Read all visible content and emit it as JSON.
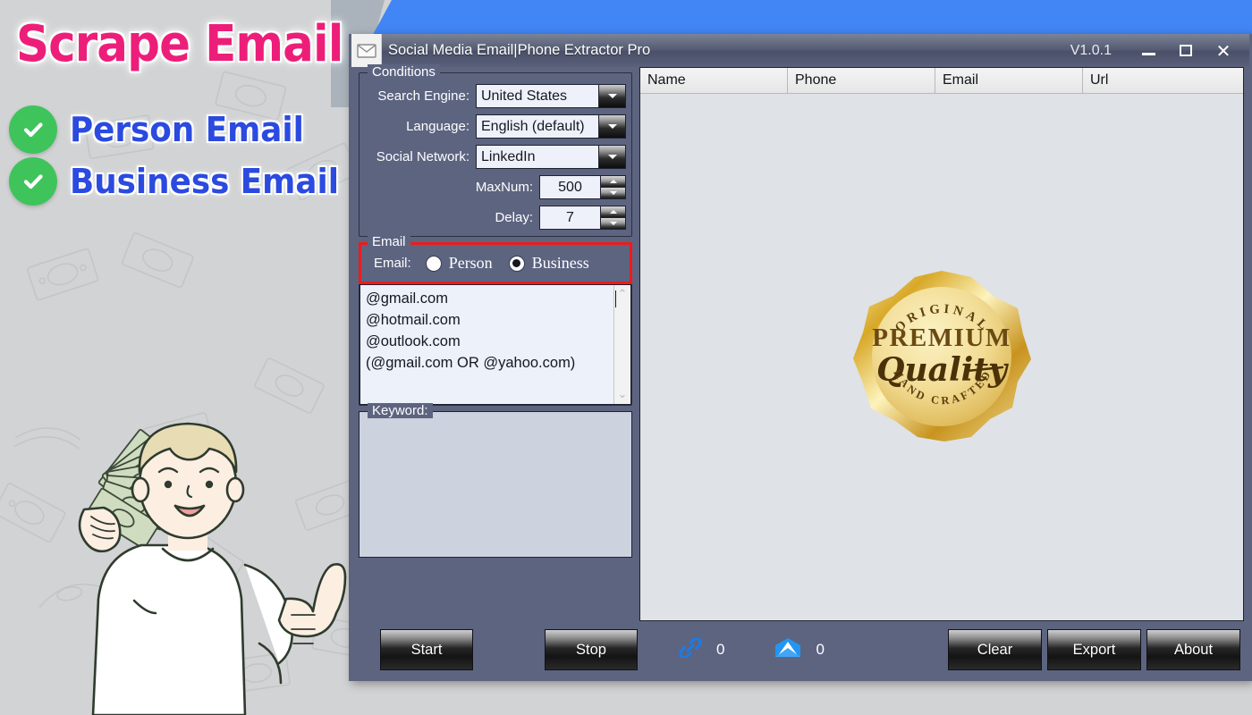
{
  "promo": {
    "title": "Scrape Email",
    "bullets": [
      {
        "label": "Person Email",
        "icon": "check-circle-icon"
      },
      {
        "label": "Business Email",
        "icon": "check-circle-icon"
      }
    ]
  },
  "window": {
    "icon": "envelope-icon",
    "title": "Social Media Email|Phone Extractor Pro",
    "version": "V1.0.1",
    "controls": {
      "minimize": "minimize-icon",
      "maximize": "maximize-icon",
      "close": "close-icon"
    }
  },
  "conditions": {
    "legend": "Conditions",
    "fields": [
      {
        "label": "Search Engine:",
        "value": "United States",
        "type": "combo"
      },
      {
        "label": "Language:",
        "value": "English (default)",
        "type": "combo"
      },
      {
        "label": "Social Network:",
        "value": "LinkedIn",
        "type": "combo"
      },
      {
        "label": "MaxNum:",
        "value": "500",
        "type": "spinner"
      },
      {
        "label": "Delay:",
        "value": "7",
        "type": "spinner"
      }
    ]
  },
  "email": {
    "legend": "Email",
    "row_label": "Email:",
    "options": [
      {
        "label": "Person",
        "checked": false
      },
      {
        "label": "Business",
        "checked": true
      }
    ],
    "highlight_color": "#ee1b1b",
    "list": [
      "@gmail.com",
      "@hotmail.com",
      "@outlook.com",
      "(@gmail.com OR @yahoo.com)"
    ],
    "scroll_up": "scroll-up-icon",
    "scroll_down": "scroll-down-icon"
  },
  "keyword": {
    "legend": "Keyword:",
    "value": "",
    "placeholder": ""
  },
  "results": {
    "columns": [
      "Name",
      "Phone",
      "Email",
      "Url"
    ],
    "rows": [],
    "badge": {
      "top_text": "ORIGINAL",
      "main_text": "PREMIUM",
      "script_text": "Quality",
      "bottom_text": "HAND CRAFTED",
      "color": "#d9a326"
    }
  },
  "footer": {
    "start_label": "Start",
    "stop_label": "Stop",
    "counters": [
      {
        "icon": "link-icon",
        "value": "0"
      },
      {
        "icon": "mail-icon",
        "value": "0"
      }
    ],
    "clear_label": "Clear",
    "export_label": "Export",
    "about_label": "About"
  },
  "colors": {
    "panel": "#5d6480",
    "accent_blue": "#4285f4",
    "promo_pink": "#ed1e79",
    "promo_blue": "#2b4ae0",
    "check_green": "#3fc45c",
    "highlight_red": "#ee1b1b"
  }
}
